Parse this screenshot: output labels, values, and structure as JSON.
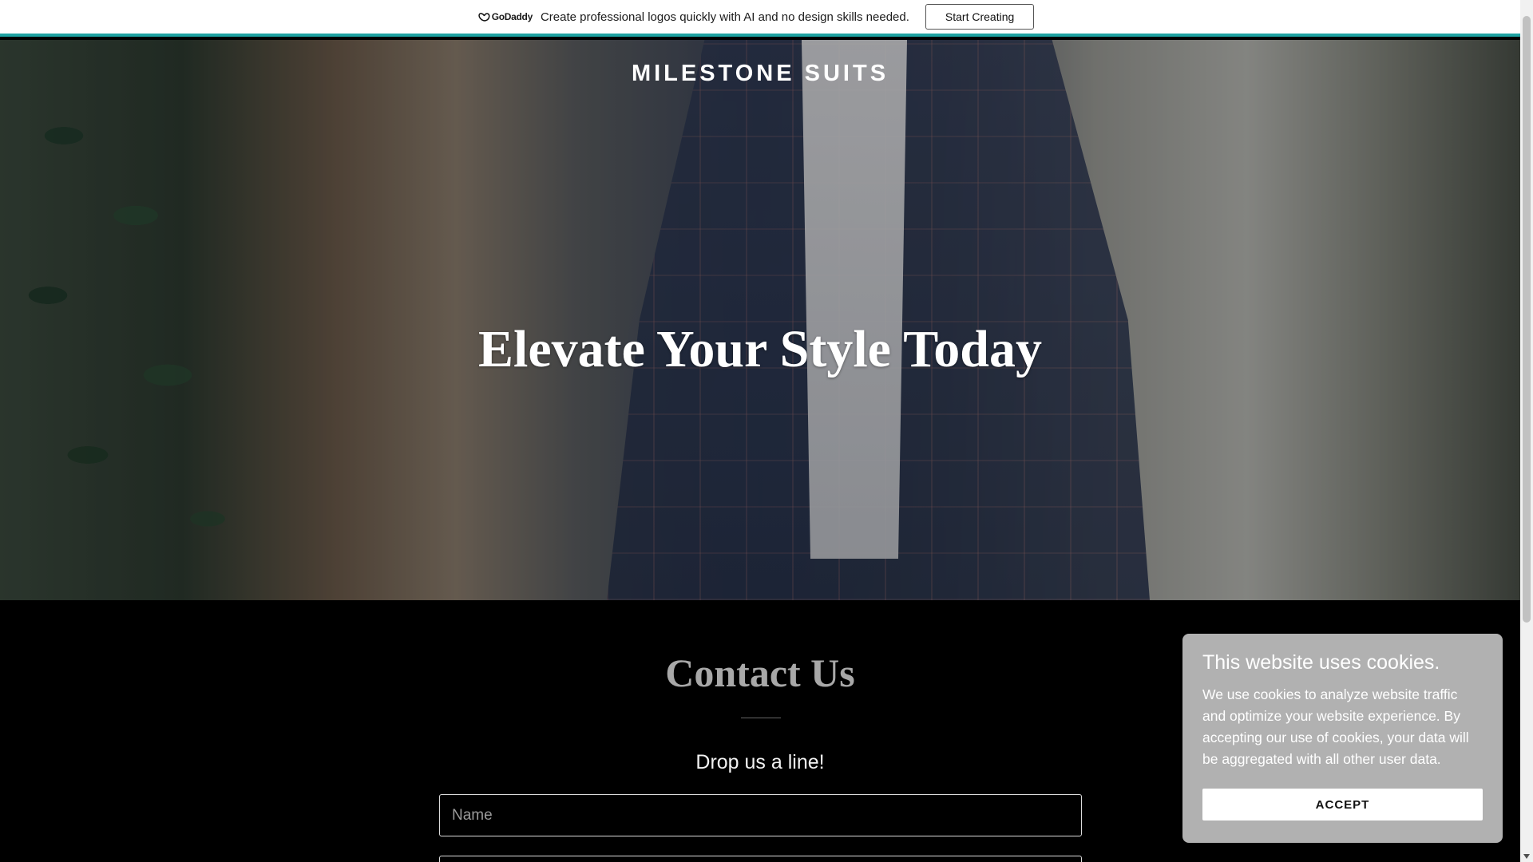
{
  "promo": {
    "brand": "GoDaddy",
    "message": "Create professional logos quickly with AI and no design skills needed.",
    "button_label": "Start Creating"
  },
  "hero": {
    "site_title": "MILESTONE SUITS",
    "heading": "Elevate Your Style Today"
  },
  "contact": {
    "title": "Contact Us",
    "subtitle": "Drop us a line!",
    "name_placeholder": "Name"
  },
  "cookie": {
    "title": "This website uses cookies.",
    "text": "We use cookies to analyze website traffic and optimize your website experience. By accepting our use of cookies, your data will be aggregated with all other user data.",
    "accept_label": "ACCEPT"
  },
  "colors": {
    "promo_accent": "#1ea3a3",
    "cookie_panel": "#b1b1b1"
  }
}
